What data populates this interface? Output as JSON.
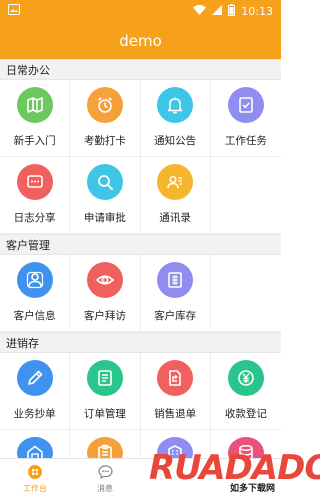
{
  "status_bar": {
    "time": "10:13"
  },
  "header": {
    "title": "demo"
  },
  "colors": {
    "brand": "#f7a11a",
    "green": "#6cc75f",
    "orange": "#f5a03a",
    "cyan": "#3fc5e8",
    "purple": "#8f8ef0",
    "red": "#f0605f",
    "blue": "#3f93ee",
    "yellow": "#f5b52d",
    "teal": "#29c58d"
  },
  "sections": [
    {
      "title": "日常办公",
      "items": [
        {
          "label": "新手入门",
          "icon": "map-icon",
          "color": "#6cc75f"
        },
        {
          "label": "考勤打卡",
          "icon": "alarm-clock-icon",
          "color": "#f5a03a"
        },
        {
          "label": "通知公告",
          "icon": "bell-icon",
          "color": "#3fc5e8"
        },
        {
          "label": "工作任务",
          "icon": "task-check-icon",
          "color": "#8f8ef0"
        },
        {
          "label": "日志分享",
          "icon": "message-icon",
          "color": "#f0605f"
        },
        {
          "label": "申请审批",
          "icon": "search-icon",
          "color": "#3fc5e8"
        },
        {
          "label": "通讯录",
          "icon": "contact-card-icon",
          "color": "#f5b52d"
        }
      ]
    },
    {
      "title": "客户管理",
      "items": [
        {
          "label": "客户信息",
          "icon": "customers-icon",
          "color": "#3f93ee"
        },
        {
          "label": "客户拜访",
          "icon": "eye-icon",
          "color": "#f0605f"
        },
        {
          "label": "客户库存",
          "icon": "inventory-icon",
          "color": "#8f8ef0"
        }
      ]
    },
    {
      "title": "进销存",
      "items": [
        {
          "label": "业务抄单",
          "icon": "pencil-icon",
          "color": "#3f93ee"
        },
        {
          "label": "订单管理",
          "icon": "order-list-icon",
          "color": "#29c58d"
        },
        {
          "label": "销售退单",
          "icon": "return-doc-icon",
          "color": "#f0605f"
        },
        {
          "label": "收款登记",
          "icon": "yen-icon",
          "color": "#29c58d"
        }
      ]
    }
  ],
  "partial_row": [
    {
      "icon": "warehouse-icon",
      "color": "#3f93ee"
    },
    {
      "icon": "clipboard-icon",
      "color": "#f5a03a"
    },
    {
      "icon": "building-icon",
      "color": "#8f8ef0"
    },
    {
      "icon": "database-icon",
      "color": "#e9527a"
    }
  ],
  "tabs": [
    {
      "label": "工作台",
      "icon": "workbench-icon",
      "active": true
    },
    {
      "label": "消息",
      "icon": "chat-icon",
      "active": false
    }
  ],
  "watermark": {
    "logo": "RUADADO",
    "text": "如多下载网"
  }
}
